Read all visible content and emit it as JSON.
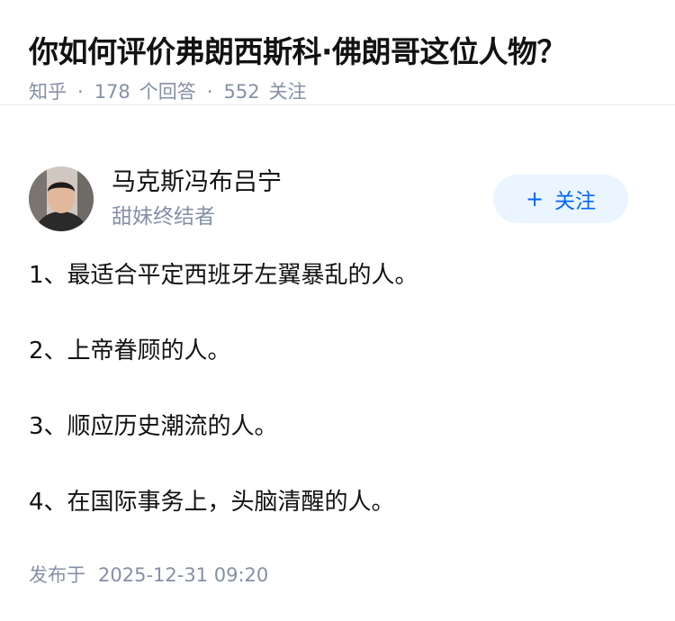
{
  "question": {
    "title": "你如何评价弗朗西斯科·佛朗哥这位人物？",
    "source": "知乎",
    "answer_count": "178",
    "answer_label": "个回答",
    "follower_count": "552",
    "follower_label": "关注"
  },
  "author": {
    "name": "马克斯冯布吕宁",
    "headline": "甜妹终结者",
    "follow_plus": "+",
    "follow_label": "关注"
  },
  "answer": {
    "paragraphs": [
      "1、最适合平定西班牙左翼暴乱的人。",
      "2、上帝眷顾的人。",
      "3、顺应历史潮流的人。",
      "4、在国际事务上，头脑清醒的人。"
    ],
    "published_label": "发布于",
    "published_time": "2025-12-31 09:20"
  },
  "colors": {
    "meta_gray": "#8590a6",
    "follow_bg": "#ebf5ff",
    "follow_text": "#0066ff"
  }
}
